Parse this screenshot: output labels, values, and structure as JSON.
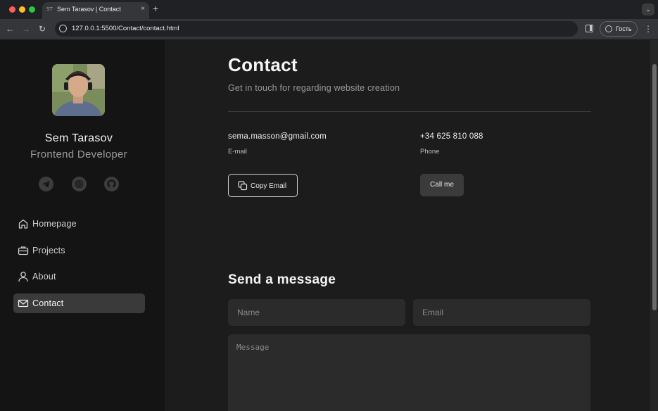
{
  "browser": {
    "tab_favicon": "ST",
    "tab_title": "Sem Tarasov | Contact",
    "tab_close": "×",
    "new_tab": "+",
    "tab_menu": "⌄",
    "back": "←",
    "forward": "→",
    "reload": "↻",
    "url": "127.0.0.1:5500/Contact/contact.html",
    "profile_label": "Гость",
    "menu": "⋮"
  },
  "sidebar": {
    "name": "Sem Tarasov",
    "role": "Frontend Developer",
    "social": [
      {
        "icon": "telegram-icon"
      },
      {
        "icon": "instagram-icon"
      },
      {
        "icon": "github-icon"
      }
    ],
    "nav": [
      {
        "label": "Homepage",
        "icon": "home-icon",
        "active": false
      },
      {
        "label": "Projects",
        "icon": "briefcase-icon",
        "active": false
      },
      {
        "label": "About",
        "icon": "user-icon",
        "active": false
      },
      {
        "label": "Contact",
        "icon": "mail-icon",
        "active": true
      }
    ]
  },
  "main": {
    "title": "Contact",
    "subtitle": "Get in touch for regarding website creation",
    "email": {
      "value": "sema.masson@gmail.com",
      "label": "E-mail",
      "button": "Copy Email"
    },
    "phone": {
      "value": "+34 625 810 088",
      "label": "Phone",
      "button": "Call me"
    },
    "form": {
      "title": "Send a message",
      "name_placeholder": "Name",
      "email_placeholder": "Email",
      "message_placeholder": "Message"
    }
  },
  "colors": {
    "background": "#1c1c1c",
    "sidebar": "#141414",
    "active_nav": "#3a3a3a",
    "input": "#2b2b2b"
  }
}
